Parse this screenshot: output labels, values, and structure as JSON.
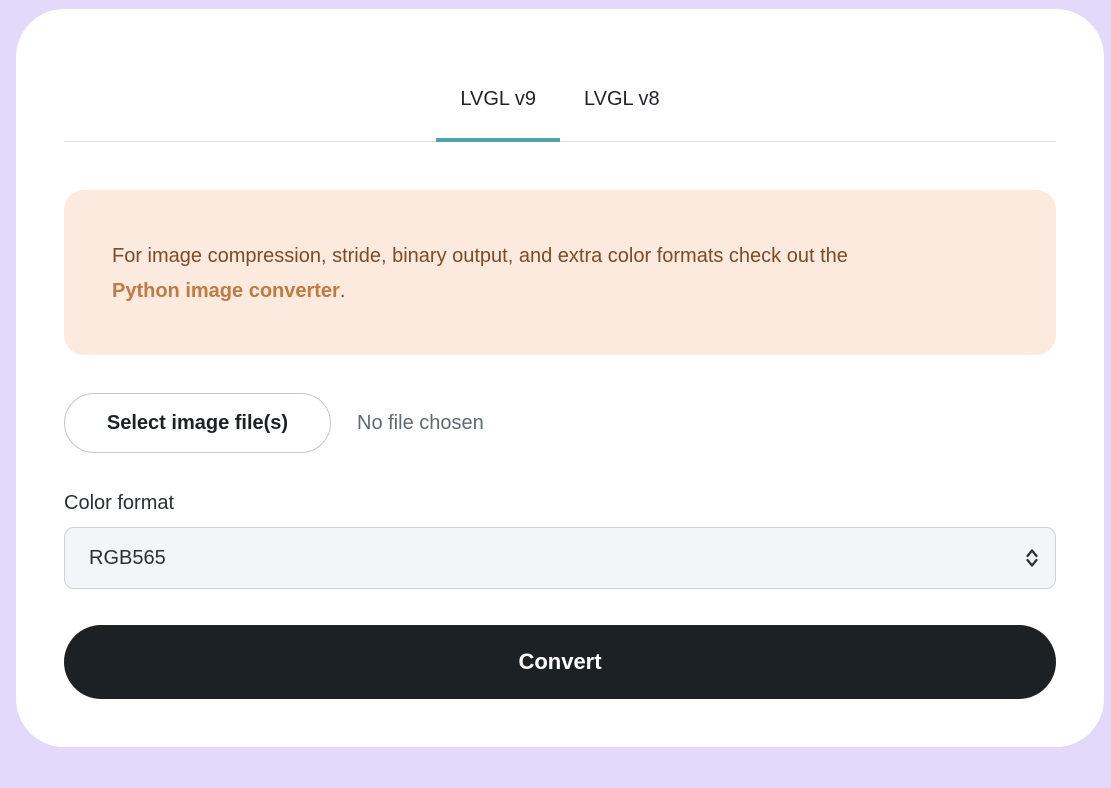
{
  "tabs": [
    {
      "label": "LVGL v9",
      "active": true
    },
    {
      "label": "LVGL v8",
      "active": false
    }
  ],
  "notice": {
    "text": "For image compression, stride, binary output, and extra color formats check out the ",
    "link_text": "Python image converter",
    "suffix": "."
  },
  "file_input": {
    "button_label": "Select image file(s)",
    "status": "No file chosen"
  },
  "color_format": {
    "label": "Color format",
    "selected": "RGB565"
  },
  "convert_button": {
    "label": "Convert"
  },
  "colors": {
    "page_background": "#e3d9fa",
    "card_background": "#ffffff",
    "tab_indicator": "#52a2a9",
    "notice_background": "#fbeadd",
    "notice_text": "#7f4a26",
    "notice_link": "#c07a44",
    "primary_button": "#1b2125"
  },
  "icons": {
    "select_arrows": "up-down-chevron-icon"
  }
}
